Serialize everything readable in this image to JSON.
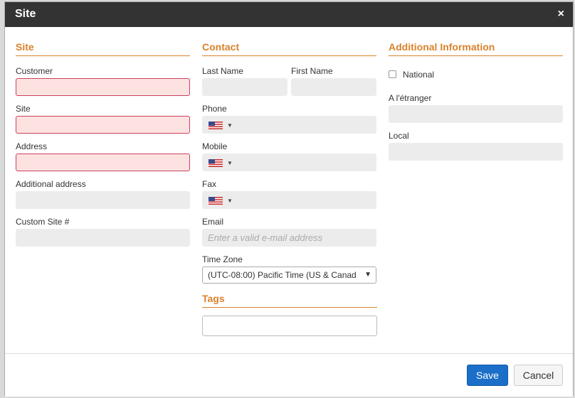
{
  "dialog": {
    "title": "Site",
    "close_glyph": "×"
  },
  "site": {
    "heading": "Site",
    "customer_label": "Customer",
    "site_label": "Site",
    "address_label": "Address",
    "additional_address_label": "Additional address",
    "custom_site_label": "Custom Site #"
  },
  "contact": {
    "heading": "Contact",
    "last_name_label": "Last Name",
    "first_name_label": "First Name",
    "phone_label": "Phone",
    "mobile_label": "Mobile",
    "fax_label": "Fax",
    "email_label": "Email",
    "email_placeholder": "Enter a valid e-mail address",
    "timezone_label": "Time Zone",
    "timezone_value": "(UTC-08:00) Pacific Time (US & Canad",
    "flag_caret": "▼",
    "select_arrow": "▼"
  },
  "tags": {
    "heading": "Tags"
  },
  "additional": {
    "heading": "Additional Information",
    "national_label": "National",
    "abroad_label": "A l'étranger",
    "local_label": "Local"
  },
  "footer": {
    "save_label": "Save",
    "cancel_label": "Cancel"
  },
  "colors": {
    "accent": "#d9822b",
    "primary": "#1b6fc8",
    "error_border": "#c9415b",
    "error_bg": "#fde2e2"
  }
}
